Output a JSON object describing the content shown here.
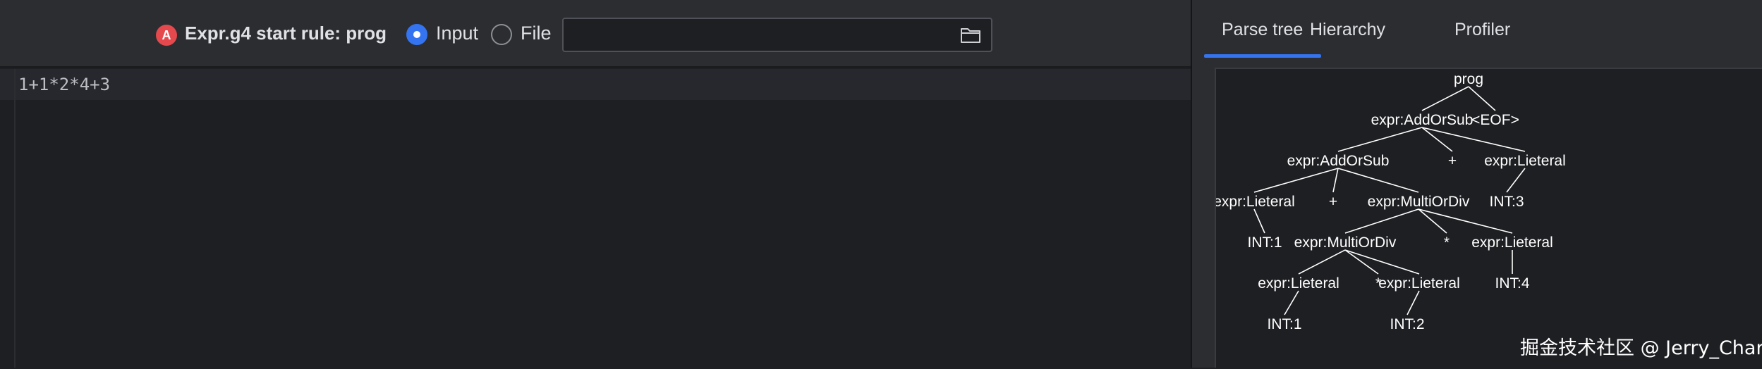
{
  "toolbar": {
    "error_badge": "A",
    "rule_label": "Expr.g4 start rule: prog",
    "input_label": "Input",
    "file_label": "File",
    "file_path_value": "",
    "selected_source": "Input"
  },
  "editor": {
    "lines": [
      "1+1*2*4+3"
    ]
  },
  "tabs": [
    {
      "label": "Parse tree",
      "active": true
    },
    {
      "label": "Hierarchy",
      "active": false
    },
    {
      "label": "Profiler",
      "active": false
    }
  ],
  "parse_tree": {
    "nodes": {
      "root": "prog",
      "add_outer": "expr:AddOrSub",
      "eof": "<EOF>",
      "add_inner": "expr:AddOrSub",
      "plus_outer": "+",
      "lit_3": "expr:Lieteral",
      "lit_1a": "expr:Lieteral",
      "plus_inner": "+",
      "mul_outer": "expr:MultiOrDiv",
      "int_3": "INT:3",
      "int_1a": "INT:1",
      "mul_inner": "expr:MultiOrDiv",
      "star_outer": "*",
      "lit_4": "expr:Lieteral",
      "lit_1b": "expr:Lieteral",
      "star_inner": "*",
      "lit_2": "expr:Lieteral",
      "int_4": "INT:4",
      "int_1b": "INT:1",
      "int_2": "INT:2"
    },
    "edges": [
      [
        "root",
        "add_outer"
      ],
      [
        "root",
        "eof"
      ],
      [
        "add_outer",
        "add_inner"
      ],
      [
        "add_outer",
        "plus_outer"
      ],
      [
        "add_outer",
        "lit_3"
      ],
      [
        "add_inner",
        "lit_1a"
      ],
      [
        "add_inner",
        "plus_inner"
      ],
      [
        "add_inner",
        "mul_outer"
      ],
      [
        "lit_3",
        "int_3"
      ],
      [
        "lit_1a",
        "int_1a"
      ],
      [
        "mul_outer",
        "mul_inner"
      ],
      [
        "mul_outer",
        "star_outer"
      ],
      [
        "mul_outer",
        "lit_4"
      ],
      [
        "mul_inner",
        "lit_1b"
      ],
      [
        "mul_inner",
        "star_inner"
      ],
      [
        "mul_inner",
        "lit_2"
      ],
      [
        "lit_4",
        "int_4"
      ],
      [
        "lit_1b",
        "int_1b"
      ],
      [
        "lit_2",
        "int_2"
      ]
    ]
  },
  "watermark": "掘金技术社区 @ Jerry_Chan",
  "colors": {
    "accent": "#3574f0",
    "error": "#e5484d",
    "panel_bg": "#2b2d30",
    "editor_bg": "#1e1f22"
  }
}
